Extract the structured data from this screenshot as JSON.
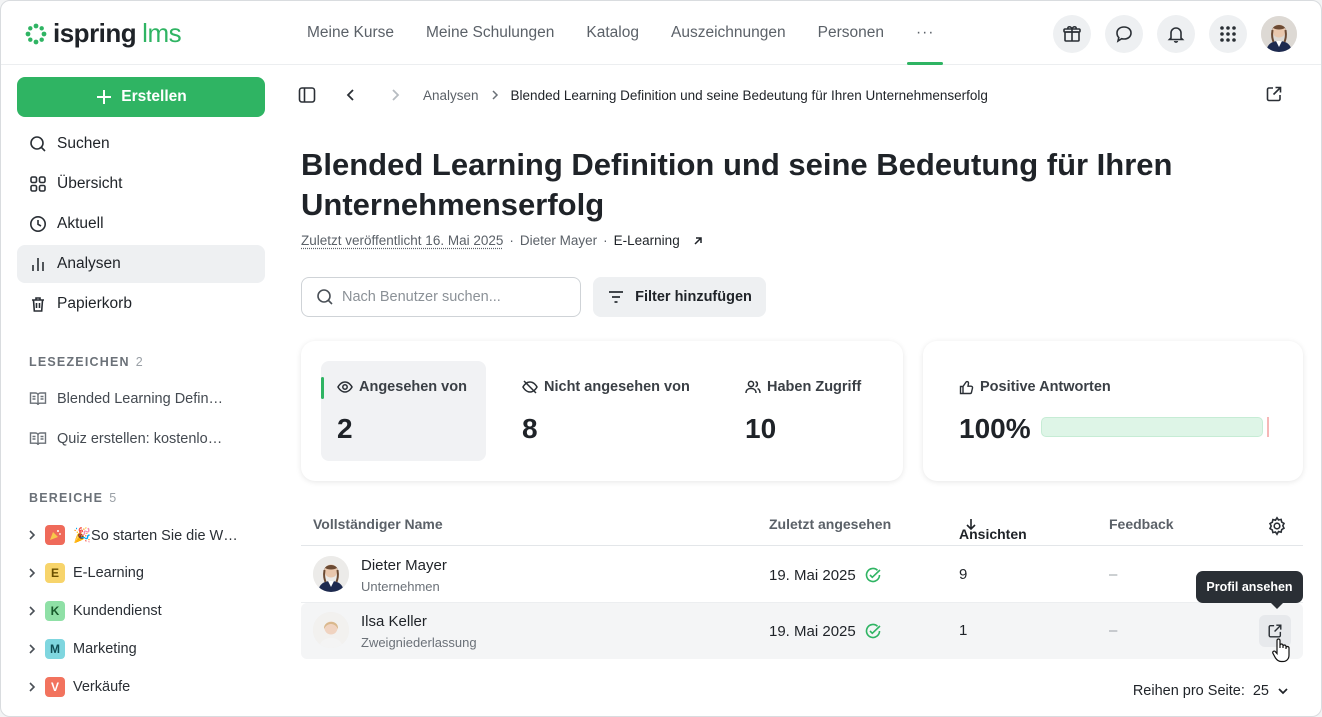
{
  "app": {
    "brand": "ispring",
    "product": "lms",
    "brand_color": "#2fb463"
  },
  "topnav": {
    "items": [
      "Meine Kurse",
      "Meine Schulungen",
      "Katalog",
      "Auszeichnungen",
      "Personen"
    ],
    "more": "···"
  },
  "top_icons": [
    "gift-icon",
    "chat-icon",
    "bell-icon",
    "apps-grid-icon"
  ],
  "sidebar": {
    "create_label": "Erstellen",
    "items": [
      {
        "label": "Suchen",
        "icon": "search-icon"
      },
      {
        "label": "Übersicht",
        "icon": "grid-icon"
      },
      {
        "label": "Aktuell",
        "icon": "clock-icon"
      },
      {
        "label": "Analysen",
        "icon": "bar-chart-icon",
        "active": true
      },
      {
        "label": "Papierkorb",
        "icon": "trash-icon"
      }
    ],
    "bookmarks_title": "LESEZEICHEN",
    "bookmarks_count": "2",
    "bookmarks": [
      "Blended Learning Defin…",
      "Quiz erstellen: kostenlo…"
    ],
    "areas_title": "BEREICHE",
    "areas_count": "5",
    "areas": [
      {
        "badge": "🎉",
        "label": "🎉So starten Sie die W…",
        "color": "#ef6a5a"
      },
      {
        "badge": "E",
        "label": "E-Learning",
        "color": "#f7d46b"
      },
      {
        "badge": "K",
        "label": "Kundendienst",
        "color": "#8fe0a6"
      },
      {
        "badge": "M",
        "label": "Marketing",
        "color": "#7fd6df"
      },
      {
        "badge": "V",
        "label": "Verkäufe",
        "color": "#f2735e"
      }
    ]
  },
  "breadcrumb": {
    "parent": "Analysen",
    "current": "Blended Learning Definition und seine Bedeutung für Ihren Unternehmenserfolg"
  },
  "page": {
    "title": "Blended Learning Definition und seine Bedeutung für Ihren Unternehmenserfolg",
    "published": "Zuletzt veröffentlicht 16. Mai 2025",
    "author": "Dieter Mayer",
    "course": "E-Learning",
    "sep": "·"
  },
  "search": {
    "placeholder": "Nach Benutzer suchen..."
  },
  "filter": {
    "label": "Filter hinzufügen"
  },
  "stats": {
    "viewed": {
      "label": "Angesehen von",
      "value": "2"
    },
    "not_viewed": {
      "label": "Nicht angesehen von",
      "value": "8"
    },
    "access": {
      "label": "Haben Zugriff",
      "value": "10"
    },
    "positive": {
      "label": "Positive Antworten",
      "value": "100%",
      "fraction": 1.0
    }
  },
  "table": {
    "columns": {
      "name": "Vollständiger Name",
      "last_viewed": "Zuletzt angesehen",
      "views": "Ansichten",
      "feedback": "Feedback"
    },
    "rows": [
      {
        "name": "Dieter Mayer",
        "org": "Unternehmen",
        "date": "19. Mai 2025",
        "views": "9",
        "feedback": "–"
      },
      {
        "name": "Ilsa Keller",
        "org": "Zweigniederlassung",
        "date": "19. Mai 2025",
        "views": "1",
        "feedback": "–"
      }
    ]
  },
  "tooltip": "Profil ansehen",
  "pager": {
    "label": "Reihen pro Seite:",
    "value": "25"
  }
}
